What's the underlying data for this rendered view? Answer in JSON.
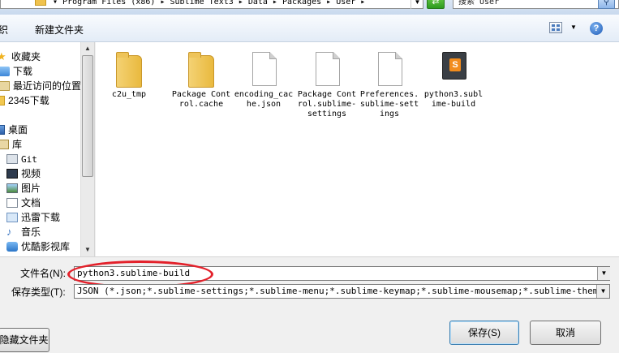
{
  "address": {
    "path": "▾ Program Files (x86) ▸ Sublime Text3 ▸ Data ▸ Packages ▸ User ▸",
    "search_placeholder": "搜索 User"
  },
  "toolbar": {
    "organize_label": "织",
    "new_folder_label": "新建文件夹",
    "help_label": "?"
  },
  "nav": {
    "items": [
      {
        "label": "收藏夹",
        "icon": "star-icon"
      },
      {
        "label": "下载",
        "icon": "download-icon"
      },
      {
        "label": "最近访问的位置",
        "icon": "recent-places-icon"
      },
      {
        "label": "2345下载",
        "icon": "folder-icon"
      },
      {
        "label": "桌面",
        "icon": "desktop-icon"
      },
      {
        "label": "库",
        "icon": "library-icon"
      },
      {
        "label": "Git",
        "icon": "git-icon"
      },
      {
        "label": "视频",
        "icon": "video-icon"
      },
      {
        "label": "图片",
        "icon": "pictures-icon"
      },
      {
        "label": "文档",
        "icon": "documents-icon"
      },
      {
        "label": "迅雷下载",
        "icon": "thunder-download-icon"
      },
      {
        "label": "音乐",
        "icon": "music-icon"
      },
      {
        "label": "优酷影视库",
        "icon": "youku-icon"
      }
    ]
  },
  "files": [
    {
      "name": "c2u_tmp",
      "type": "folder"
    },
    {
      "name": "Package Control.cache",
      "type": "folder"
    },
    {
      "name": "encoding_cache.json",
      "type": "file"
    },
    {
      "name": "Package Control.sublime-settings",
      "type": "file"
    },
    {
      "name": "Preferences.sublime-settings",
      "type": "file"
    },
    {
      "name": "python3.sublime-build",
      "type": "sublime"
    }
  ],
  "form": {
    "filename_label": "文件名(N):",
    "filename_value": "python3.sublime-build",
    "filetype_label": "保存类型(T):",
    "filetype_value": "JSON (*.json;*.sublime-settings;*.sublime-menu;*.sublime-keymap;*.sublime-mousemap;*.sublime-theme;*.sublim"
  },
  "buttons": {
    "hide_folders": "隐藏文件夹",
    "save": "保存(S)",
    "cancel": "取消"
  },
  "colors": {
    "annotation": "#e3202a"
  }
}
